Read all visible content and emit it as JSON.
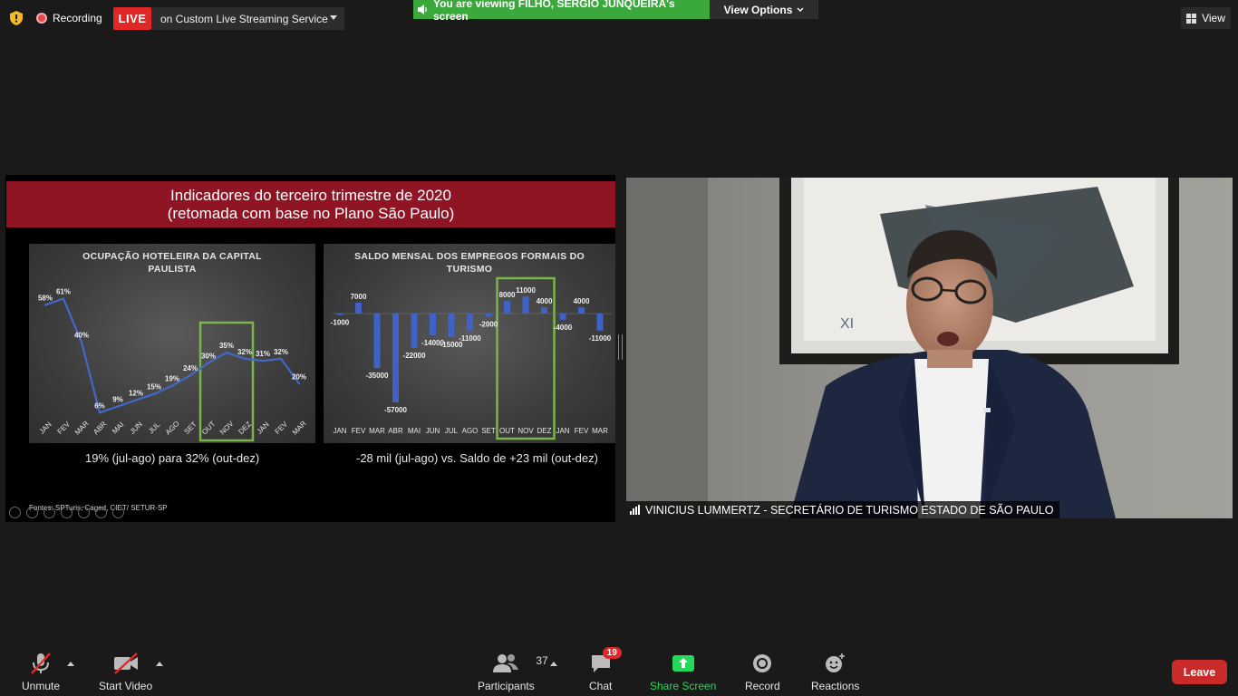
{
  "top_bar": {
    "recording_label": "Recording",
    "live_badge": "LIVE",
    "live_service": "on Custom Live Streaming Service",
    "viewing_text": "You are viewing FILHO, SERGIO JUNQUEIRA's screen",
    "view_options": "View Options",
    "view_label": "View"
  },
  "slide": {
    "title_line1": "Indicadores do terceiro trimestre de 2020",
    "title_line2": "(retomada com base no Plano São Paulo)",
    "caption_left": "19% (jul-ago) para 32% (out-dez)",
    "caption_right": "-28 mil (jul-ago) vs. Saldo de +23 mil (out-dez)",
    "source": "Fontes: SPTuris, Caged, CIET/ SETUR-SP"
  },
  "chart_data": [
    {
      "type": "line",
      "title": "OCUPAÇÃO HOTELEIRA DA CAPITAL PAULISTA",
      "title_line1": "OCUPAÇÃO HOTELEIRA DA CAPITAL",
      "title_line2": "PAULISTA",
      "categories": [
        "JAN",
        "FEV",
        "MAR",
        "ABR",
        "MAI",
        "JUN",
        "JUL",
        "AGO",
        "SET",
        "OUT",
        "NOV",
        "DEZ",
        "JAN",
        "FEV",
        "MAR"
      ],
      "values": [
        58,
        61,
        40,
        6,
        9,
        12,
        15,
        19,
        24,
        30,
        35,
        32,
        31,
        32,
        20
      ],
      "labels": [
        "58%",
        "61%",
        "40%",
        "6%",
        "9%",
        "12%",
        "15%",
        "19%",
        "24%",
        "30%",
        "35%",
        "32%",
        "31%",
        "32%",
        "20%"
      ],
      "ylim": [
        0,
        70
      ],
      "highlight": [
        "OUT",
        "DEZ"
      ],
      "line_color": "#4169c9"
    },
    {
      "type": "bar",
      "title": "SALDO MENSAL DOS EMPREGOS FORMAIS DO TURISMO",
      "title_line1": "SALDO MENSAL DOS EMPREGOS FORMAIS DO",
      "title_line2": "TURISMO",
      "categories": [
        "JAN",
        "FEV",
        "MAR",
        "ABR",
        "MAI",
        "JUN",
        "JUL",
        "AGO",
        "SET",
        "OUT",
        "NOV",
        "DEZ",
        "JAN",
        "FEV",
        "MAR"
      ],
      "values": [
        -1000,
        7000,
        -35000,
        -57000,
        -22000,
        -14000,
        -15000,
        -11000,
        -2000,
        8000,
        11000,
        4000,
        -4000,
        4000,
        -11000
      ],
      "labels": [
        "-1000",
        "7000",
        "-35000",
        "-57000",
        "-22000",
        "-14000",
        "-15000",
        "-11000",
        "-2000",
        "8000",
        "11000",
        "4000",
        "-4000",
        "4000",
        "-11000"
      ],
      "ylim": [
        -60000,
        15000
      ],
      "highlight": [
        "OUT",
        "DEZ"
      ],
      "bar_color": "#3f62c7"
    }
  ],
  "video": {
    "participant_name": "VINICIUS LUMMERTZ - SECRETÁRIO DE TURISMO ESTADO DE SÃO PAULO"
  },
  "toolbar": {
    "unmute": "Unmute",
    "start_video": "Start Video",
    "participants": "Participants",
    "participants_count": "37",
    "chat": "Chat",
    "chat_badge": "19",
    "share_screen": "Share Screen",
    "record": "Record",
    "reactions": "Reactions",
    "leave": "Leave"
  },
  "colors": {
    "share_green": "#23d959",
    "live_red": "#e02828",
    "leave_red": "#c92a2a",
    "slide_title_bg": "#8f1424",
    "highlight_box": "#7ab648"
  }
}
